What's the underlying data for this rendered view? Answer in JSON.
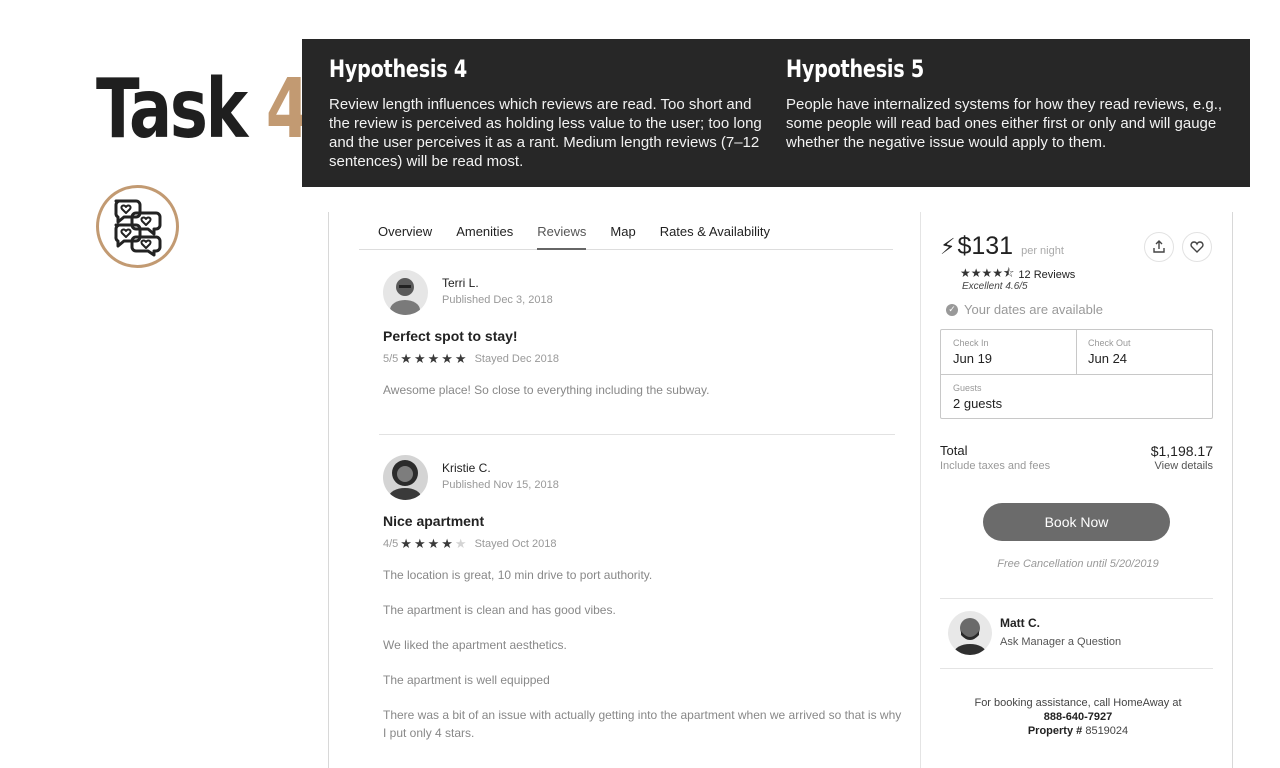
{
  "header": {
    "task_word": "Task",
    "task_number": "4",
    "accent": "#c29a72",
    "icon": "chat-bubbles-hearts-icon"
  },
  "hypotheses": [
    {
      "title": "Hypothesis 4",
      "text": "Review length influences which reviews are read. Too short and the review is perceived as holding less value to the user; too long and the user perceives it as a rant. Medium length reviews (7–12 sentences) will be read most."
    },
    {
      "title": "Hypothesis 5",
      "text": "People have internalized systems for how they read reviews, e.g., some people will read bad ones either first or only and will gauge whether the negative issue would apply to them."
    }
  ],
  "tabs": [
    {
      "label": "Overview"
    },
    {
      "label": "Amenities"
    },
    {
      "label": "Reviews",
      "active": true
    },
    {
      "label": "Map"
    },
    {
      "label": "Rates & Availability"
    }
  ],
  "reviews": [
    {
      "name": "Terri L.",
      "published": "Published Dec 3, 2018",
      "title": "Perfect spot to stay!",
      "score": "5/5",
      "stars": 5,
      "stayed": "Stayed Dec 2018",
      "paragraphs": [
        "Awesome place! So close to everything including the subway."
      ]
    },
    {
      "name": "Kristie C.",
      "published": "Published Nov 15, 2018",
      "title": "Nice apartment",
      "score": "4/5",
      "stars": 4,
      "stayed": "Stayed Oct 2018",
      "paragraphs": [
        "The location is great, 10 min drive to port authority.",
        "The apartment is clean and has good vibes.",
        "We liked the apartment aesthetics.",
        "The apartment is well equipped",
        "There was a bit of an issue with actually getting into the apartment when we arrived so that is why I put only 4 stars."
      ]
    }
  ],
  "booking": {
    "price": "$131",
    "per_night": "per night",
    "stars": "4.5",
    "reviews_count": "12 Reviews",
    "excellent": "Excellent 4.6/5",
    "available": "Your dates are available",
    "check_in_label": "Check In",
    "check_in": "Jun 19",
    "check_out_label": "Check Out",
    "check_out": "Jun 24",
    "guests_label": "Guests",
    "guests": "2 guests",
    "total_label": "Total",
    "total_sub": "Include taxes and fees",
    "total": "$1,198.17",
    "view_details": "View details",
    "book_now": "Book Now",
    "free_cancel": "Free Cancellation until 5/20/2019",
    "manager_name": "Matt C.",
    "manager_ask": "Ask Manager a Question",
    "assist_line": "For booking assistance, call HomeAway at",
    "phone": "888-640-7927",
    "property_label": "Property #",
    "property_id": "8519024"
  }
}
